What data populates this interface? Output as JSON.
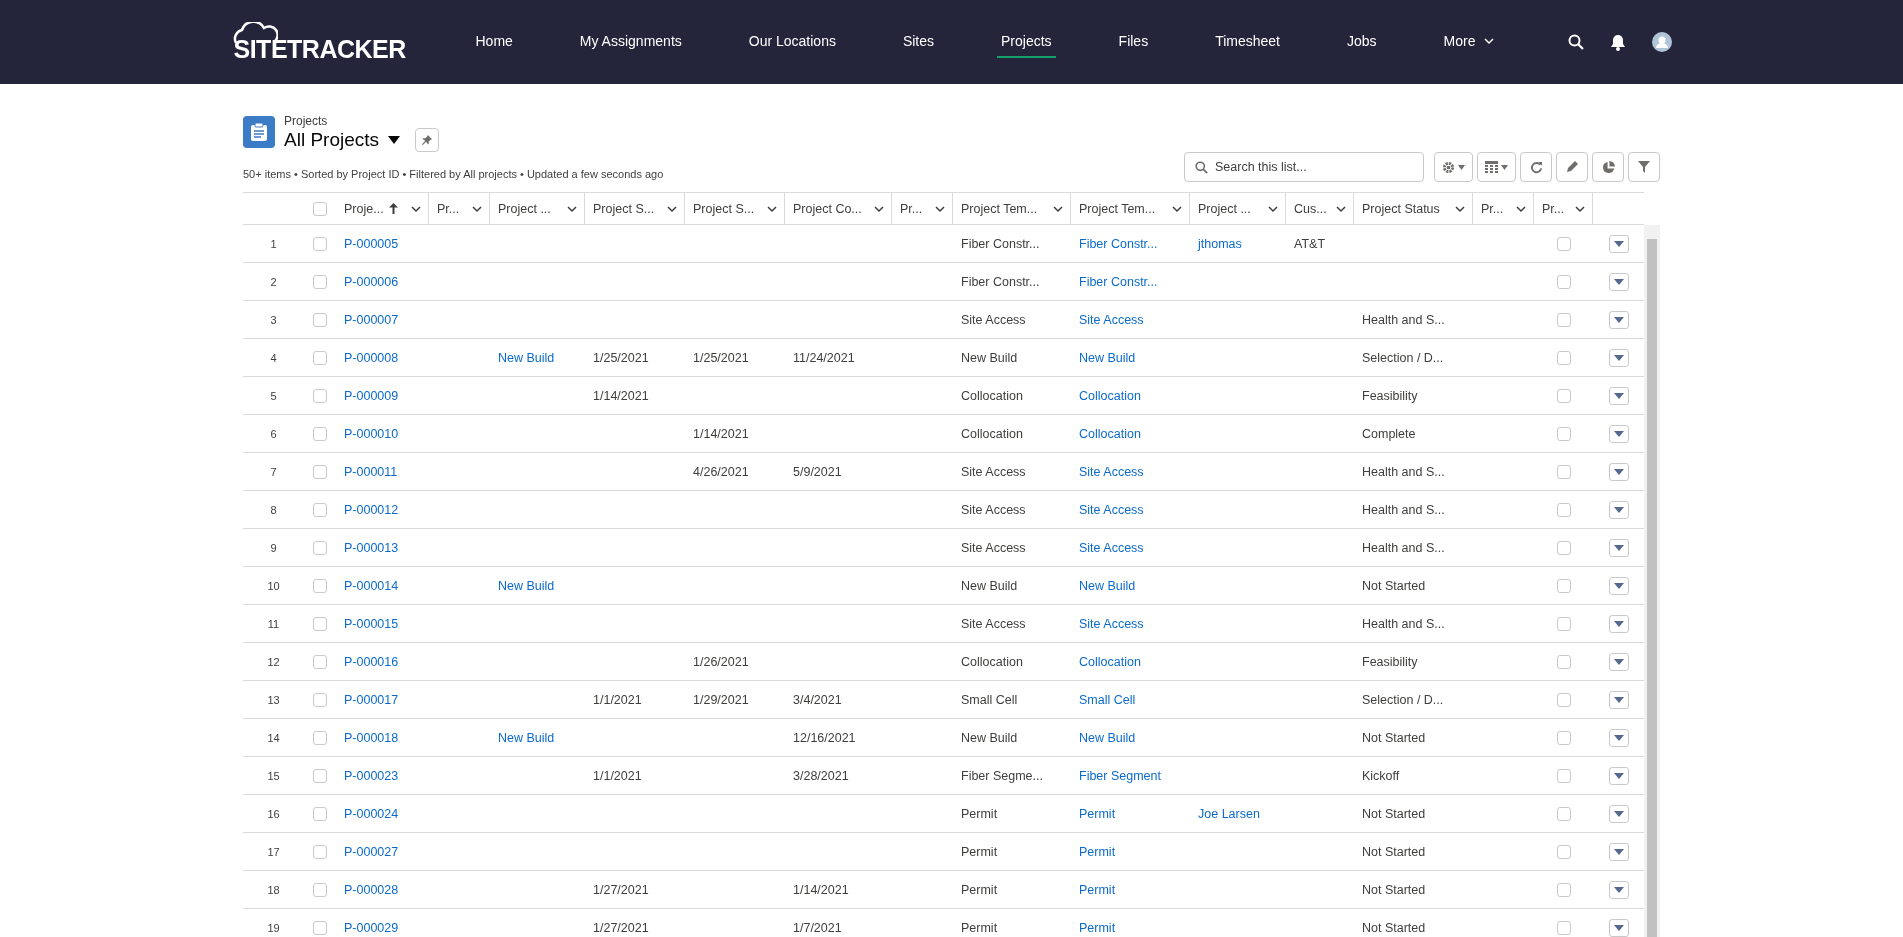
{
  "header": {
    "logo": "SITETRACKER",
    "nav": [
      {
        "label": "Home",
        "selected": false,
        "kind": "link"
      },
      {
        "label": "My Assignments",
        "selected": false,
        "kind": "link"
      },
      {
        "label": "Our Locations",
        "selected": false,
        "kind": "link"
      },
      {
        "label": "Sites",
        "selected": false,
        "kind": "link"
      },
      {
        "label": "Projects",
        "selected": true,
        "kind": "link"
      },
      {
        "label": "Files",
        "selected": false,
        "kind": "link"
      },
      {
        "label": "Timesheet",
        "selected": false,
        "kind": "link"
      },
      {
        "label": "Jobs",
        "selected": false,
        "kind": "link"
      },
      {
        "label": "More",
        "selected": false,
        "kind": "menu"
      }
    ]
  },
  "list_view": {
    "object": "Projects",
    "title": "All Projects",
    "meta": "50+ items • Sorted by Project ID • Filtered by All projects • Updated a few seconds ago",
    "search": {
      "placeholder": "Search this list..."
    }
  },
  "table": {
    "all_selected": false,
    "columns": [
      {
        "label": "Proje...",
        "kind": "link",
        "sorted": true
      },
      {
        "label": "Pr...",
        "kind": "text",
        "sorted": false
      },
      {
        "label": "Project ...",
        "kind": "link",
        "sorted": false
      },
      {
        "label": "Project S...",
        "kind": "text",
        "sorted": false
      },
      {
        "label": "Project S...",
        "kind": "text",
        "sorted": false
      },
      {
        "label": "Project Co...",
        "kind": "text",
        "sorted": false
      },
      {
        "label": "Pr...",
        "kind": "text",
        "sorted": false
      },
      {
        "label": "Project Tem...",
        "kind": "text",
        "sorted": false
      },
      {
        "label": "Project Tem...",
        "kind": "link",
        "sorted": false
      },
      {
        "label": "Project ...",
        "kind": "link",
        "sorted": false
      },
      {
        "label": "Cus...",
        "kind": "text",
        "sorted": false
      },
      {
        "label": "Project Status",
        "kind": "text",
        "sorted": false
      },
      {
        "label": "Pr...",
        "kind": "text",
        "sorted": false
      },
      {
        "label": "Pr...",
        "kind": "checkbox",
        "sorted": false
      }
    ],
    "rows": [
      {
        "number": "1",
        "selected": false,
        "checked": false,
        "cells": {
          "column_1": "P-000005",
          "column_8": "Fiber Constr...",
          "column_9": "Fiber Constr...",
          "column_10": "jthomas",
          "column_11": "AT&T"
        }
      },
      {
        "number": "2",
        "selected": false,
        "checked": false,
        "cells": {
          "column_1": "P-000006",
          "column_8": "Fiber Constr...",
          "column_9": "Fiber Constr..."
        }
      },
      {
        "number": "3",
        "selected": false,
        "checked": false,
        "cells": {
          "column_1": "P-000007",
          "column_8": "Site Access",
          "column_9": "Site Access",
          "column_12": "Health and S..."
        }
      },
      {
        "number": "4",
        "selected": false,
        "checked": false,
        "cells": {
          "column_1": "P-000008",
          "column_3": "New Build",
          "column_4": "1/25/2021",
          "column_5": "1/25/2021",
          "column_6": "11/24/2021",
          "column_8": "New Build",
          "column_9": "New Build",
          "column_12": "Selection / D..."
        }
      },
      {
        "number": "5",
        "selected": false,
        "checked": false,
        "cells": {
          "column_1": "P-000009",
          "column_4": "1/14/2021",
          "column_8": "Collocation",
          "column_9": "Collocation",
          "column_12": "Feasibility"
        }
      },
      {
        "number": "6",
        "selected": false,
        "checked": false,
        "cells": {
          "column_1": "P-000010",
          "column_5": "1/14/2021",
          "column_8": "Collocation",
          "column_9": "Collocation",
          "column_12": "Complete"
        }
      },
      {
        "number": "7",
        "selected": false,
        "checked": false,
        "cells": {
          "column_1": "P-000011",
          "column_5": "4/26/2021",
          "column_6": "5/9/2021",
          "column_8": "Site Access",
          "column_9": "Site Access",
          "column_12": "Health and S..."
        }
      },
      {
        "number": "8",
        "selected": false,
        "checked": false,
        "cells": {
          "column_1": "P-000012",
          "column_8": "Site Access",
          "column_9": "Site Access",
          "column_12": "Health and S..."
        }
      },
      {
        "number": "9",
        "selected": false,
        "checked": false,
        "cells": {
          "column_1": "P-000013",
          "column_8": "Site Access",
          "column_9": "Site Access",
          "column_12": "Health and S..."
        }
      },
      {
        "number": "10",
        "selected": false,
        "checked": false,
        "cells": {
          "column_1": "P-000014",
          "column_3": "New Build",
          "column_8": "New Build",
          "column_9": "New Build",
          "column_12": "Not Started"
        }
      },
      {
        "number": "11",
        "selected": false,
        "checked": false,
        "cells": {
          "column_1": "P-000015",
          "column_8": "Site Access",
          "column_9": "Site Access",
          "column_12": "Health and S..."
        }
      },
      {
        "number": "12",
        "selected": false,
        "checked": false,
        "cells": {
          "column_1": "P-000016",
          "column_5": "1/26/2021",
          "column_8": "Collocation",
          "column_9": "Collocation",
          "column_12": "Feasibility"
        }
      },
      {
        "number": "13",
        "selected": false,
        "checked": false,
        "cells": {
          "column_1": "P-000017",
          "column_4": "1/1/2021",
          "column_5": "1/29/2021",
          "column_6": "3/4/2021",
          "column_8": "Small Cell",
          "column_9": "Small Cell",
          "column_12": "Selection / D..."
        }
      },
      {
        "number": "14",
        "selected": false,
        "checked": false,
        "cells": {
          "column_1": "P-000018",
          "column_3": "New Build",
          "column_6": "12/16/2021",
          "column_8": "New Build",
          "column_9": "New Build",
          "column_12": "Not Started"
        }
      },
      {
        "number": "15",
        "selected": false,
        "checked": false,
        "cells": {
          "column_1": "P-000023",
          "column_4": "1/1/2021",
          "column_6": "3/28/2021",
          "column_8": "Fiber Segme...",
          "column_9": "Fiber Segment",
          "column_12": "Kickoff"
        }
      },
      {
        "number": "16",
        "selected": false,
        "checked": false,
        "cells": {
          "column_1": "P-000024",
          "column_8": "Permit",
          "column_9": "Permit",
          "column_10": "Joe Larsen",
          "column_12": "Not Started"
        }
      },
      {
        "number": "17",
        "selected": false,
        "checked": false,
        "cells": {
          "column_1": "P-000027",
          "column_8": "Permit",
          "column_9": "Permit",
          "column_12": "Not Started"
        }
      },
      {
        "number": "18",
        "selected": false,
        "checked": false,
        "cells": {
          "column_1": "P-000028",
          "column_4": "1/27/2021",
          "column_6": "1/14/2021",
          "column_8": "Permit",
          "column_9": "Permit",
          "column_12": "Not Started"
        }
      },
      {
        "number": "19",
        "selected": false,
        "checked": false,
        "cells": {
          "column_1": "P-000029",
          "column_4": "1/27/2021",
          "column_6": "1/7/2021",
          "column_8": "Permit",
          "column_9": "Permit",
          "column_12": "Not Started"
        }
      }
    ]
  }
}
